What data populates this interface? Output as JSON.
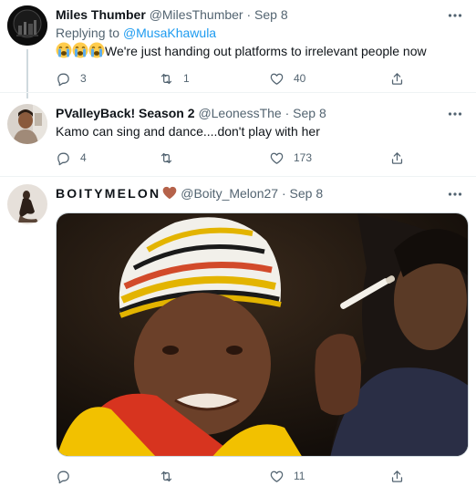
{
  "tweets": [
    {
      "name": "Miles Thumber",
      "handle": "@MilesThumber",
      "dot": "·",
      "date": "Sep 8",
      "replying_prefix": "Replying to ",
      "replying_to": "@MusaKhawula",
      "text": "We're just handing out platforms to irrelevant people now",
      "emojis": [
        "loudly-crying-face",
        "loudly-crying-face",
        "loudly-crying-face"
      ],
      "replies": "3",
      "retweets": "1",
      "likes": "40"
    },
    {
      "name": "PValleyBack! Season 2",
      "handle": "@LeonessThe",
      "dot": "·",
      "date": "Sep 8",
      "text": "Kamo can sing and dance....don't play with her",
      "replies": "4",
      "retweets": "",
      "likes": "173"
    },
    {
      "name": "BOITYMELON",
      "name_emoji": "brown-heart",
      "handle": "@Boity_Melon27",
      "dot": "·",
      "date": "Sep 8",
      "replies": "",
      "retweets": "",
      "likes": "11",
      "image": "photo-of-woman-in-striped-beanie"
    }
  ],
  "colors": {
    "secondary_text": "#536471",
    "link": "#1d9bf0",
    "thread_line": "#cfd9de",
    "divider": "#eff3f4"
  }
}
